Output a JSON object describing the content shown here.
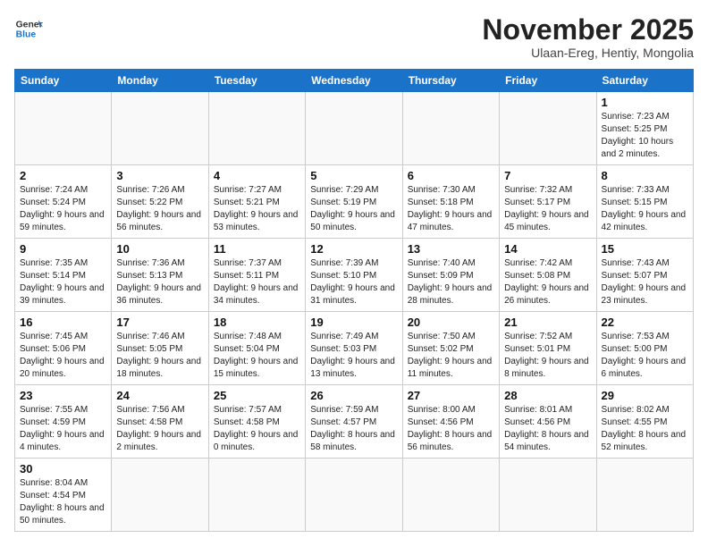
{
  "logo": {
    "general": "General",
    "blue": "Blue"
  },
  "header": {
    "title": "November 2025",
    "subtitle": "Ulaan-Ereg, Hentiy, Mongolia"
  },
  "weekdays": [
    "Sunday",
    "Monday",
    "Tuesday",
    "Wednesday",
    "Thursday",
    "Friday",
    "Saturday"
  ],
  "weeks": [
    [
      {
        "day": "",
        "info": ""
      },
      {
        "day": "",
        "info": ""
      },
      {
        "day": "",
        "info": ""
      },
      {
        "day": "",
        "info": ""
      },
      {
        "day": "",
        "info": ""
      },
      {
        "day": "",
        "info": ""
      },
      {
        "day": "1",
        "info": "Sunrise: 7:23 AM\nSunset: 5:25 PM\nDaylight: 10 hours and 2 minutes."
      }
    ],
    [
      {
        "day": "2",
        "info": "Sunrise: 7:24 AM\nSunset: 5:24 PM\nDaylight: 9 hours and 59 minutes."
      },
      {
        "day": "3",
        "info": "Sunrise: 7:26 AM\nSunset: 5:22 PM\nDaylight: 9 hours and 56 minutes."
      },
      {
        "day": "4",
        "info": "Sunrise: 7:27 AM\nSunset: 5:21 PM\nDaylight: 9 hours and 53 minutes."
      },
      {
        "day": "5",
        "info": "Sunrise: 7:29 AM\nSunset: 5:19 PM\nDaylight: 9 hours and 50 minutes."
      },
      {
        "day": "6",
        "info": "Sunrise: 7:30 AM\nSunset: 5:18 PM\nDaylight: 9 hours and 47 minutes."
      },
      {
        "day": "7",
        "info": "Sunrise: 7:32 AM\nSunset: 5:17 PM\nDaylight: 9 hours and 45 minutes."
      },
      {
        "day": "8",
        "info": "Sunrise: 7:33 AM\nSunset: 5:15 PM\nDaylight: 9 hours and 42 minutes."
      }
    ],
    [
      {
        "day": "9",
        "info": "Sunrise: 7:35 AM\nSunset: 5:14 PM\nDaylight: 9 hours and 39 minutes."
      },
      {
        "day": "10",
        "info": "Sunrise: 7:36 AM\nSunset: 5:13 PM\nDaylight: 9 hours and 36 minutes."
      },
      {
        "day": "11",
        "info": "Sunrise: 7:37 AM\nSunset: 5:11 PM\nDaylight: 9 hours and 34 minutes."
      },
      {
        "day": "12",
        "info": "Sunrise: 7:39 AM\nSunset: 5:10 PM\nDaylight: 9 hours and 31 minutes."
      },
      {
        "day": "13",
        "info": "Sunrise: 7:40 AM\nSunset: 5:09 PM\nDaylight: 9 hours and 28 minutes."
      },
      {
        "day": "14",
        "info": "Sunrise: 7:42 AM\nSunset: 5:08 PM\nDaylight: 9 hours and 26 minutes."
      },
      {
        "day": "15",
        "info": "Sunrise: 7:43 AM\nSunset: 5:07 PM\nDaylight: 9 hours and 23 minutes."
      }
    ],
    [
      {
        "day": "16",
        "info": "Sunrise: 7:45 AM\nSunset: 5:06 PM\nDaylight: 9 hours and 20 minutes."
      },
      {
        "day": "17",
        "info": "Sunrise: 7:46 AM\nSunset: 5:05 PM\nDaylight: 9 hours and 18 minutes."
      },
      {
        "day": "18",
        "info": "Sunrise: 7:48 AM\nSunset: 5:04 PM\nDaylight: 9 hours and 15 minutes."
      },
      {
        "day": "19",
        "info": "Sunrise: 7:49 AM\nSunset: 5:03 PM\nDaylight: 9 hours and 13 minutes."
      },
      {
        "day": "20",
        "info": "Sunrise: 7:50 AM\nSunset: 5:02 PM\nDaylight: 9 hours and 11 minutes."
      },
      {
        "day": "21",
        "info": "Sunrise: 7:52 AM\nSunset: 5:01 PM\nDaylight: 9 hours and 8 minutes."
      },
      {
        "day": "22",
        "info": "Sunrise: 7:53 AM\nSunset: 5:00 PM\nDaylight: 9 hours and 6 minutes."
      }
    ],
    [
      {
        "day": "23",
        "info": "Sunrise: 7:55 AM\nSunset: 4:59 PM\nDaylight: 9 hours and 4 minutes."
      },
      {
        "day": "24",
        "info": "Sunrise: 7:56 AM\nSunset: 4:58 PM\nDaylight: 9 hours and 2 minutes."
      },
      {
        "day": "25",
        "info": "Sunrise: 7:57 AM\nSunset: 4:58 PM\nDaylight: 9 hours and 0 minutes."
      },
      {
        "day": "26",
        "info": "Sunrise: 7:59 AM\nSunset: 4:57 PM\nDaylight: 8 hours and 58 minutes."
      },
      {
        "day": "27",
        "info": "Sunrise: 8:00 AM\nSunset: 4:56 PM\nDaylight: 8 hours and 56 minutes."
      },
      {
        "day": "28",
        "info": "Sunrise: 8:01 AM\nSunset: 4:56 PM\nDaylight: 8 hours and 54 minutes."
      },
      {
        "day": "29",
        "info": "Sunrise: 8:02 AM\nSunset: 4:55 PM\nDaylight: 8 hours and 52 minutes."
      }
    ],
    [
      {
        "day": "30",
        "info": "Sunrise: 8:04 AM\nSunset: 4:54 PM\nDaylight: 8 hours and 50 minutes."
      },
      {
        "day": "",
        "info": ""
      },
      {
        "day": "",
        "info": ""
      },
      {
        "day": "",
        "info": ""
      },
      {
        "day": "",
        "info": ""
      },
      {
        "day": "",
        "info": ""
      },
      {
        "day": "",
        "info": ""
      }
    ]
  ]
}
